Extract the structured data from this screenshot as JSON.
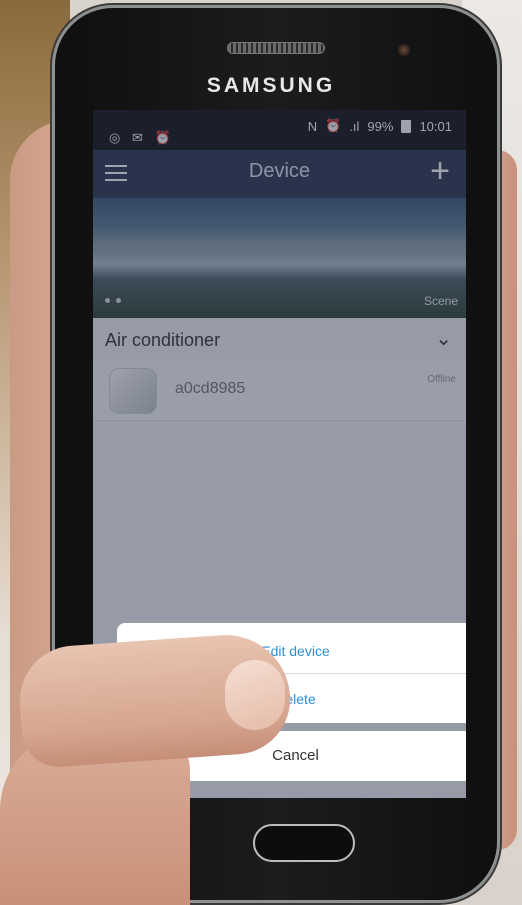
{
  "phone": {
    "brand": "SAMSUNG"
  },
  "statusbar": {
    "left_icons": "◎ ✉ ⏰",
    "nfc": "N",
    "alarm": "⏰",
    "signal": ".ıl",
    "battery": "99%",
    "time": "10:01"
  },
  "appbar": {
    "title": "Device",
    "add": "+"
  },
  "banner": {
    "scene_label": "Scene"
  },
  "group": {
    "name": "Air conditioner"
  },
  "device": {
    "name": "a0cd8985",
    "status": "Offline"
  },
  "action_sheet": {
    "edit_label": "Edit device",
    "delete_label": "Delete",
    "cancel_label": "Cancel"
  }
}
